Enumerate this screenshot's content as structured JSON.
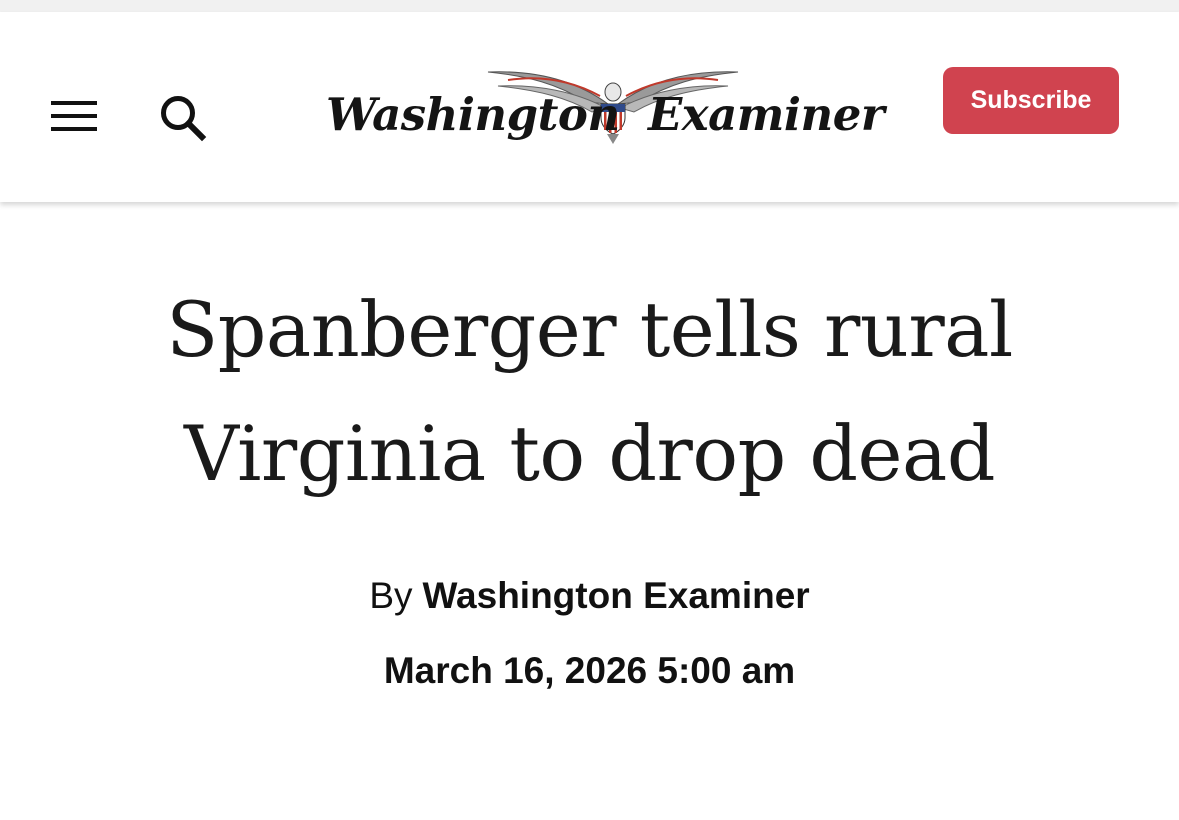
{
  "header": {
    "logo_left": "Washington",
    "logo_right": "Examiner",
    "menu_icon": "hamburger-menu-icon",
    "search_icon": "search-icon",
    "subscribe_label": "Subscribe",
    "subscribe_color": "#d0434f"
  },
  "article": {
    "headline": "Spanberger tells rural Virginia to drop dead",
    "byline_prefix": "By",
    "author": "Washington Examiner",
    "date": "March 16, 2026 5:00 am"
  }
}
